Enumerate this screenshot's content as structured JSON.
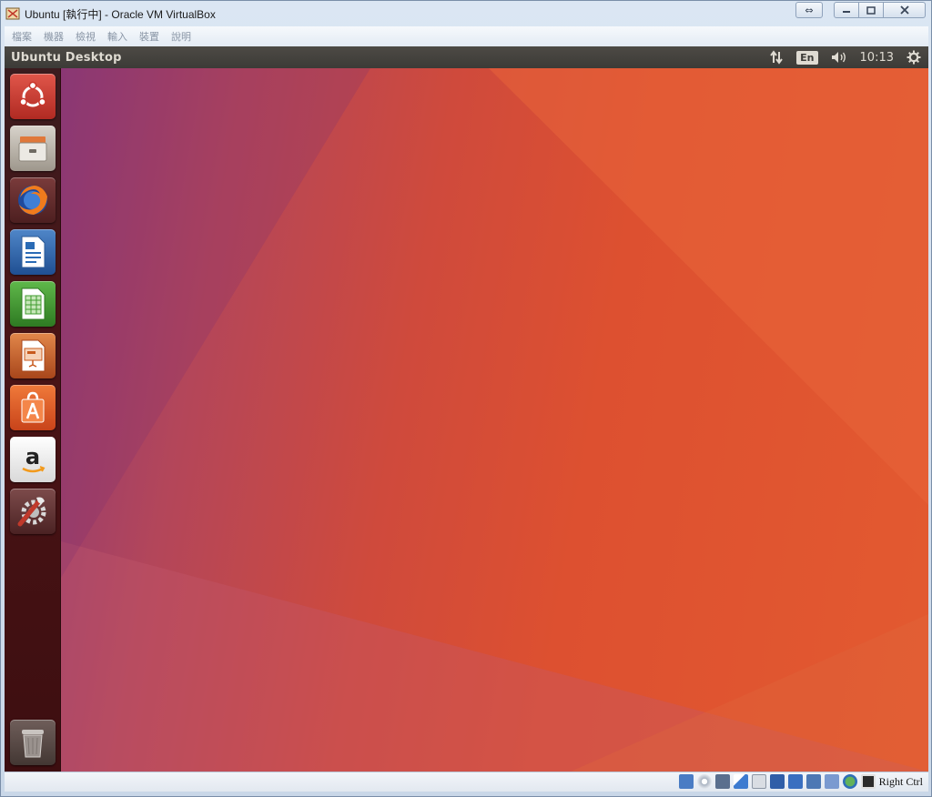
{
  "window": {
    "title": "Ubuntu [執行中] - Oracle VM VirtualBox",
    "controls": [
      "swap-icon",
      "minimize-icon",
      "maximize-icon",
      "close-icon"
    ]
  },
  "menubar": {
    "items": [
      "檔案",
      "機器",
      "檢視",
      "輸入",
      "裝置",
      "說明"
    ]
  },
  "guest": {
    "panel_title": "Ubuntu Desktop",
    "indicators": {
      "network_icon": "transfer-arrows-icon",
      "keyboard": "En",
      "volume_icon": "speaker-icon",
      "clock": "10:13",
      "session_icon": "gear-icon"
    },
    "launcher": [
      {
        "name": "ubuntu-dash",
        "icon": "ubuntu-logo-icon",
        "color": "#d33a2e"
      },
      {
        "name": "files",
        "icon": "file-cabinet-icon",
        "color": "#b9b2a6"
      },
      {
        "name": "firefox",
        "icon": "firefox-icon",
        "color": "#e66000"
      },
      {
        "name": "libreoffice-writer",
        "icon": "writer-document-icon",
        "color": "#2a6bb5"
      },
      {
        "name": "libreoffice-calc",
        "icon": "calc-spreadsheet-icon",
        "color": "#3f9b2e"
      },
      {
        "name": "libreoffice-impress",
        "icon": "impress-presentation-icon",
        "color": "#c85a1e"
      },
      {
        "name": "ubuntu-software",
        "icon": "shopping-bag-icon",
        "color": "#e5581f"
      },
      {
        "name": "amazon",
        "icon": "amazon-icon",
        "color": "#f2f2f2"
      },
      {
        "name": "system-settings",
        "icon": "settings-wrench-gear-icon",
        "color": "#c0392b"
      },
      {
        "name": "trash",
        "icon": "trash-icon",
        "color": "#8a7e78"
      }
    ]
  },
  "statusbar": {
    "icons": [
      "hard-disk-icon",
      "optical-drive-icon",
      "audio-icon",
      "shared-clipboard-icon",
      "usb-icon",
      "display-icon",
      "network-icon",
      "capture-icon",
      "vt-x-icon",
      "mouse-integration-icon",
      "keyboard-icon"
    ],
    "host_key": "Right Ctrl"
  },
  "colors": {
    "panel_bg": "#3c3b37",
    "launcher_bg": "#4a1416",
    "desktop_orange": "#e35a30",
    "desktop_purple": "#8e3a76"
  }
}
